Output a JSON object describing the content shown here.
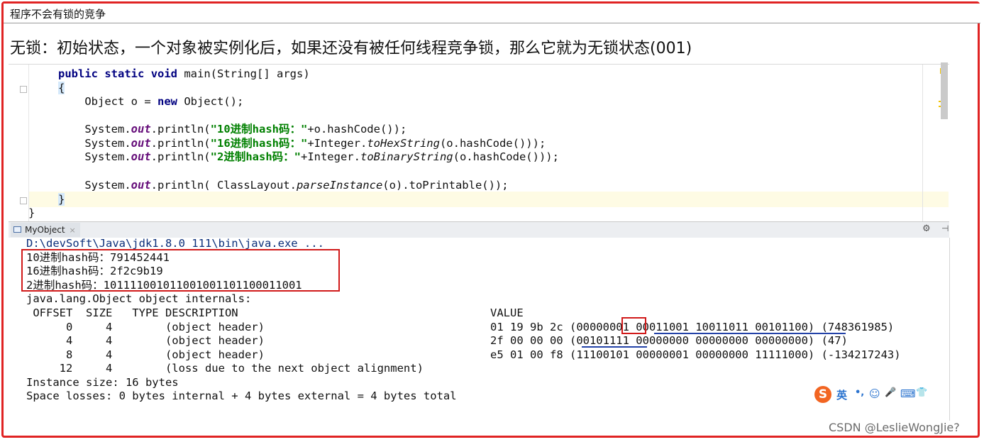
{
  "header": {
    "title": "程序不会有锁的竞争"
  },
  "description": "无锁：初始状态，一个对象被实例化后，如果还没有被任何线程竞争锁，那么它就为无锁状态(001)",
  "editor": {
    "line1": {
      "kw1": "public",
      "kw2": "static",
      "kw3": "void",
      "rest": " main(String[] args)"
    },
    "line2": {
      "brace": "{"
    },
    "line3": {
      "pre": "    Object o = ",
      "kw": "new",
      "post": " Object();"
    },
    "line4": {
      "pre": "    System.",
      "field": "out",
      "mid": ".println(",
      "str": "\"10进制hash码：\"",
      "post": "+o.hashCode());"
    },
    "line5": {
      "pre": "    System.",
      "field": "out",
      "mid": ".println(",
      "str": "\"16进制hash码：\"",
      "mid2": "+Integer.",
      "method": "toHexString",
      "post": "(o.hashCode()));"
    },
    "line6": {
      "pre": "    System.",
      "field": "out",
      "mid": ".println(",
      "str": "\"2进制hash码：\"",
      "mid2": "+Integer.",
      "method": "toBinaryString",
      "post": "(o.hashCode()));"
    },
    "line7": {
      "pre": "    System.",
      "field": "out",
      "mid": ".println( ClassLayout.",
      "method": "parseInstance",
      "post": "(o).toPrintable());"
    },
    "line8": {
      "brace": "}"
    },
    "line9": {
      "brace": "}"
    }
  },
  "run_panel": {
    "tab_label": "MyObject",
    "tab_close": "×",
    "gear_icon": "⚙",
    "pin_icon": "⊣"
  },
  "console": {
    "path": "D:\\devSoft\\Java\\jdk1.8.0_111\\bin\\java.exe ...",
    "hash10": "10进制hash码：791452441",
    "hash16": "16进制hash码：2f2c9b19",
    "hash2": "2进制hash码：101111001011001001101100011001",
    "internals_title": "java.lang.Object object internals:",
    "header_cols": " OFFSET  SIZE   TYPE DESCRIPTION",
    "value_col": "VALUE",
    "rows": [
      {
        "left": "      0     4        (object header)",
        "right": "01 19 9b 2c (00000001 00011001 10011011 00101100) (748361985)"
      },
      {
        "left": "      4     4        (object header)",
        "right": "2f 00 00 00 (00101111 00000000 00000000 00000000) (47)"
      },
      {
        "left": "      8     4        (object header)",
        "right": "e5 01 00 f8 (11100101 00000001 00000000 11111000) (-134217243)"
      },
      {
        "left": "     12     4        (loss due to the next object alignment)",
        "right": ""
      }
    ],
    "instance_size": "Instance size: 16 bytes",
    "space_losses": "Space losses: 0 bytes internal + 4 bytes external = 4 bytes total"
  },
  "ime": {
    "logo": "S",
    "lang": "英",
    "items": [
      "•,",
      "☺",
      "🎤",
      "⌨",
      "👕"
    ]
  },
  "watermark": "CSDN @LeslieWongJie?"
}
